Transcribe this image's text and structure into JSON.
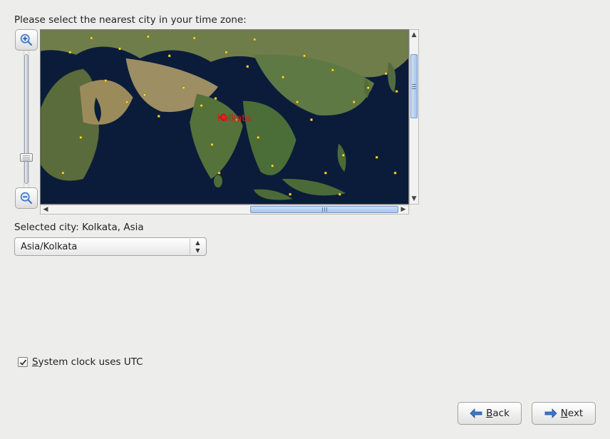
{
  "prompt": "Please select the nearest city in your time zone:",
  "selected_prefix": "Selected city: ",
  "selected_city": "Kolkata, Asia",
  "timezone_value": "Asia/Kolkata",
  "map_city_label": "Kolkata",
  "utc_checkbox": {
    "label_pre": "S",
    "label_post": "ystem clock uses UTC",
    "checked": true
  },
  "buttons": {
    "back_pre": "B",
    "back_post": "ack",
    "next_pre": "N",
    "next_post": "ext"
  },
  "icons": {
    "zoom_in": "zoom-in-icon",
    "zoom_out": "zoom-out-icon",
    "arrow_back": "arrow-left-icon",
    "arrow_next": "arrow-right-icon"
  },
  "colors": {
    "map_ocean": "#0b1c3a",
    "arrow_blue": "#3c77c9",
    "accent_red": "#d91b1b",
    "city_yellow": "#ffe438"
  }
}
